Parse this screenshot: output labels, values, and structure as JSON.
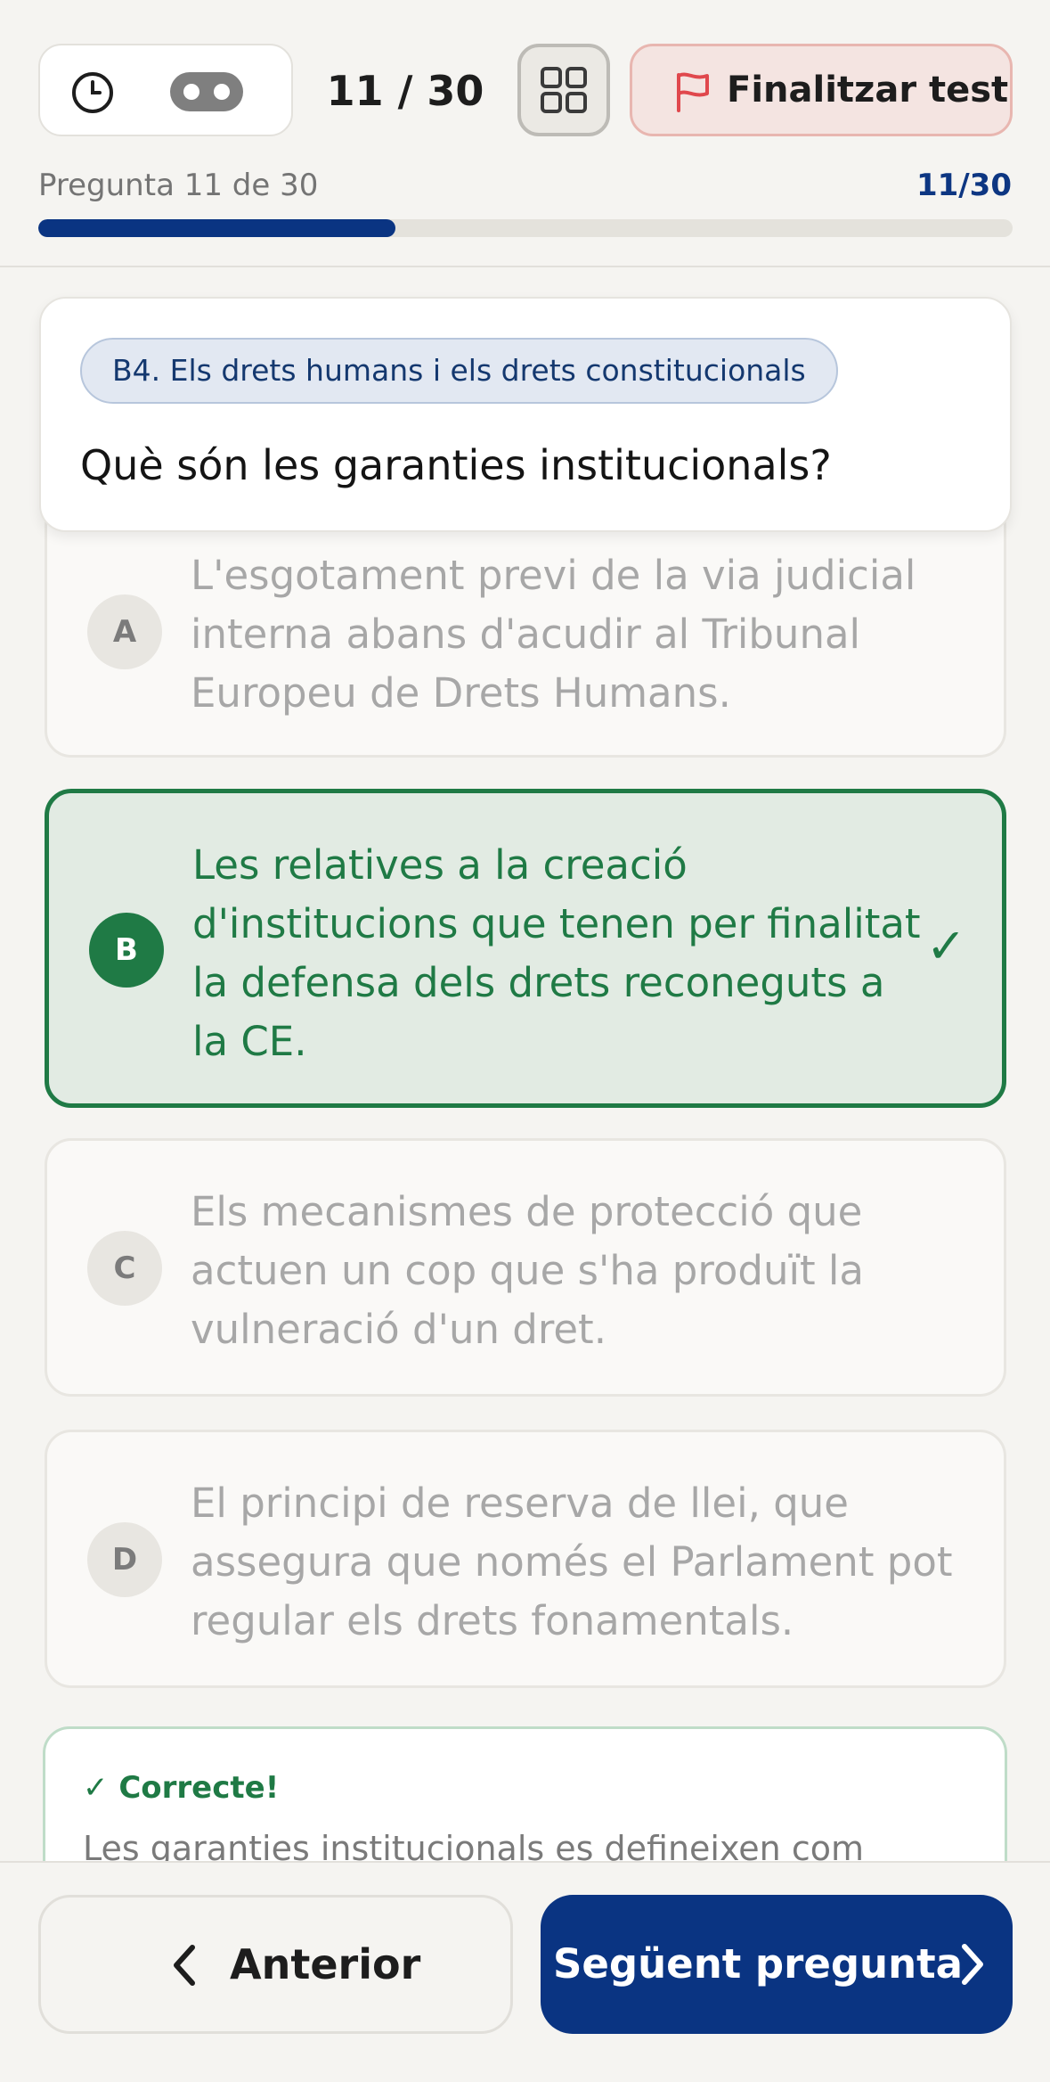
{
  "header": {
    "timer_icon": "clock-icon",
    "timer_mode_icon": "infinity-icon",
    "counter": "11 / 30",
    "grid_icon": "grid-icon",
    "finish_label": "Finalitzar test",
    "finish_icon": "flag-icon",
    "progress_label": "Pregunta 11 de 30",
    "progress_count": "11/30",
    "progress_fraction": 0.367
  },
  "question": {
    "topic": "B4. Els drets humans i els drets constitucionals",
    "text": "Què són les garanties institucionals?"
  },
  "options": [
    {
      "letter": "A",
      "text": "L'esgotament previ de la via judicial interna abans d'acudir al Tribunal Europeu de Drets Humans."
    },
    {
      "letter": "B",
      "text": "Les relatives a la creació d'institucions que tenen per finalitat la defensa dels drets reconeguts a la CE.",
      "check": "✓"
    },
    {
      "letter": "C",
      "text": "Els mecanismes de protecció que actuen un cop que s'ha produït la vulneració d'un dret."
    },
    {
      "letter": "D",
      "text": "El principi de reserva de llei, que assegura que només el Parlament pot regular els drets fonamentals."
    }
  ],
  "feedback": {
    "title": "✓ Correcte!",
    "body": "Les garanties institucionals es defineixen com"
  },
  "footer": {
    "prev_label": "Anterior",
    "next_label": "Següent pregunta"
  },
  "colors": {
    "accent": "#0a3482",
    "correct": "#1f7a45",
    "danger": "#e0484d"
  }
}
